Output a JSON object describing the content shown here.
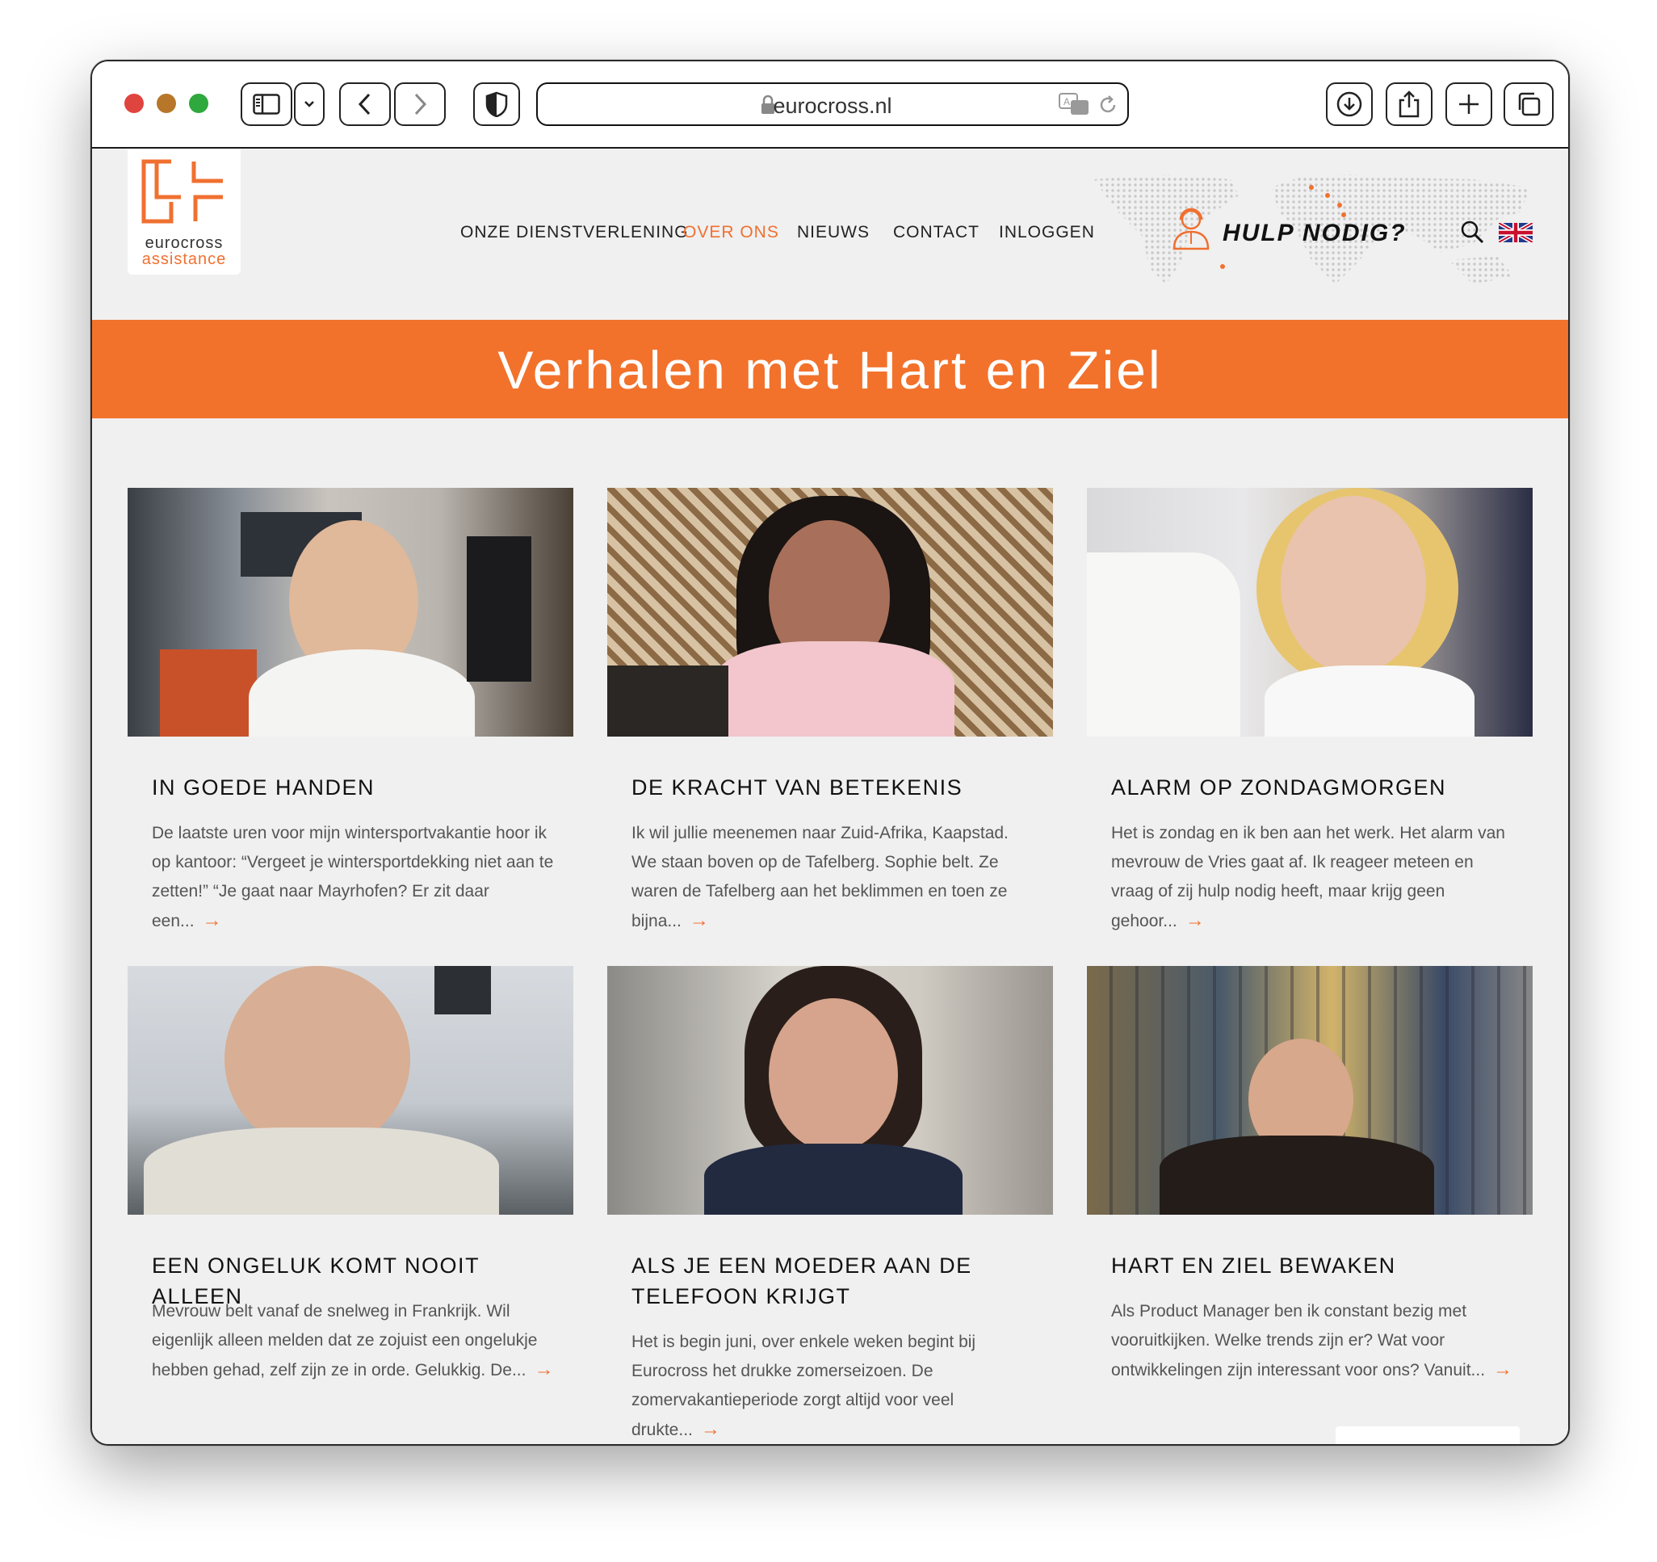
{
  "browser": {
    "url": "eurocross.nl"
  },
  "logo": {
    "line1": "eurocross",
    "line2": "assistance"
  },
  "nav": {
    "items": [
      {
        "label": "ONZE DIENSTVERLENING"
      },
      {
        "label": "OVER ONS"
      },
      {
        "label": "NIEUWS"
      },
      {
        "label": "CONTACT"
      },
      {
        "label": "INLOGGEN"
      }
    ],
    "active_index": 1
  },
  "help": {
    "label": "HULP NODIG?"
  },
  "banner": {
    "title": "Verhalen met Hart en Ziel"
  },
  "cards": [
    {
      "title": "IN GOEDE HANDEN",
      "excerpt": "De laatste uren voor mijn wintersportvakantie hoor ik op kantoor: “Vergeet je wintersportdekking niet aan te zetten!” “Je gaat naar Mayrhofen? Er zit daar een..."
    },
    {
      "title": "DE KRACHT VAN BETEKENIS",
      "excerpt": "Ik wil jullie meenemen naar Zuid-Afrika, Kaapstad. We staan boven op de Tafelberg. Sophie belt. Ze waren de Tafelberg aan het beklimmen en toen ze bijna..."
    },
    {
      "title": "ALARM OP ZONDAGMORGEN",
      "excerpt": "Het is zondag en ik ben aan het werk. Het alarm van mevrouw de Vries gaat af. Ik reageer meteen en vraag of zij hulp nodig heeft, maar krijg geen gehoor..."
    },
    {
      "title": "EEN ONGELUK KOMT NOOIT ALLEEN",
      "excerpt": "Mevrouw belt vanaf de snelweg in Frankrijk. Wil eigenlijk alleen melden dat ze zojuist een ongelukje hebben gehad, zelf zijn ze in orde. Gelukkig. De..."
    },
    {
      "title": "ALS JE EEN MOEDER AAN DE TELEFOON KRIJGT",
      "excerpt": "Het is begin juni, over enkele weken begint bij Eurocross het drukke zomerseizoen. De zomervakantieperiode zorgt altijd voor veel drukte..."
    },
    {
      "title": "HART EN ZIEL BEWAKEN",
      "excerpt": "Als Product Manager ben ik constant bezig met vooruitkijken. Welke trends zijn er? Wat voor ontwikkelingen zijn interessant voor ons? Vanuit..."
    }
  ],
  "colors": {
    "accent": "#f2722c",
    "text": "#111111",
    "muted": "#555555",
    "background": "#f0f0f0"
  },
  "icons": [
    "sidebar-icon",
    "chevron-down-icon",
    "back-icon",
    "forward-icon",
    "shield-icon",
    "lock-icon",
    "translate-icon",
    "reload-icon",
    "download-icon",
    "share-icon",
    "plus-icon",
    "tabs-icon",
    "agent-icon",
    "search-icon",
    "uk-flag-icon",
    "arrow-right-icon"
  ]
}
